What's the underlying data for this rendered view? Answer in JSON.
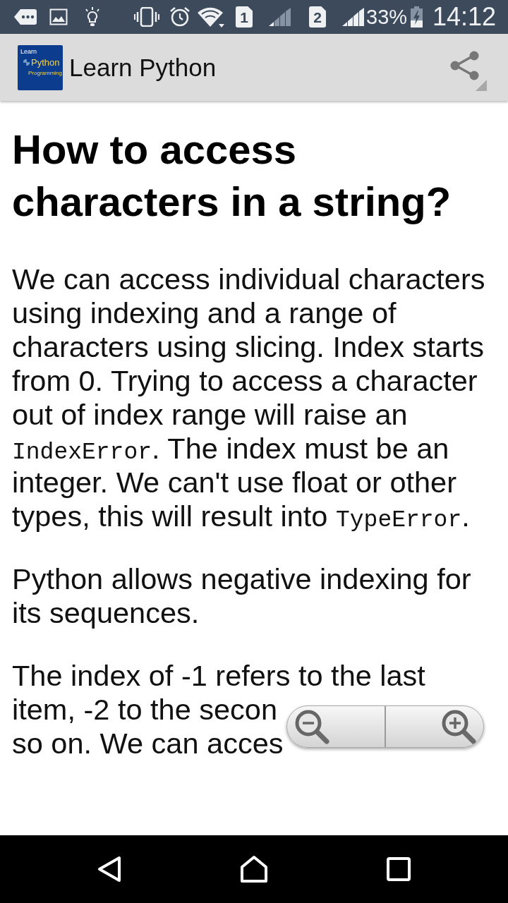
{
  "status_bar": {
    "sim_slots": [
      {
        "label": "1"
      },
      {
        "label": "2"
      }
    ],
    "battery": "33%",
    "time": "14:12"
  },
  "app_bar": {
    "logo": {
      "top": "Learn",
      "middle": "Python",
      "bottom": "Programming"
    },
    "title": "Learn Python"
  },
  "article": {
    "heading": "How to access characters in a string?",
    "paragraphs": [
      {
        "kind": "flow",
        "segments": [
          {
            "kind": "text",
            "text": "We can access individual characters using indexing and a range of characters using slicing. Index starts from 0. Trying to access a character out of index range will raise an "
          },
          {
            "kind": "code",
            "text": "IndexError"
          },
          {
            "kind": "text",
            "text": ". The index must be an integer. We can't use float or other types, this will result into "
          },
          {
            "kind": "code",
            "text": "TypeError"
          },
          {
            "kind": "text",
            "text": "."
          }
        ]
      },
      {
        "kind": "flow",
        "segments": [
          {
            "kind": "text",
            "text": "Python allows negative indexing for its sequences."
          }
        ]
      },
      {
        "kind": "lines",
        "lines": [
          "The index of -1 refers to the last",
          "item, -2 to the secon",
          "so on. We can acces"
        ]
      }
    ]
  }
}
